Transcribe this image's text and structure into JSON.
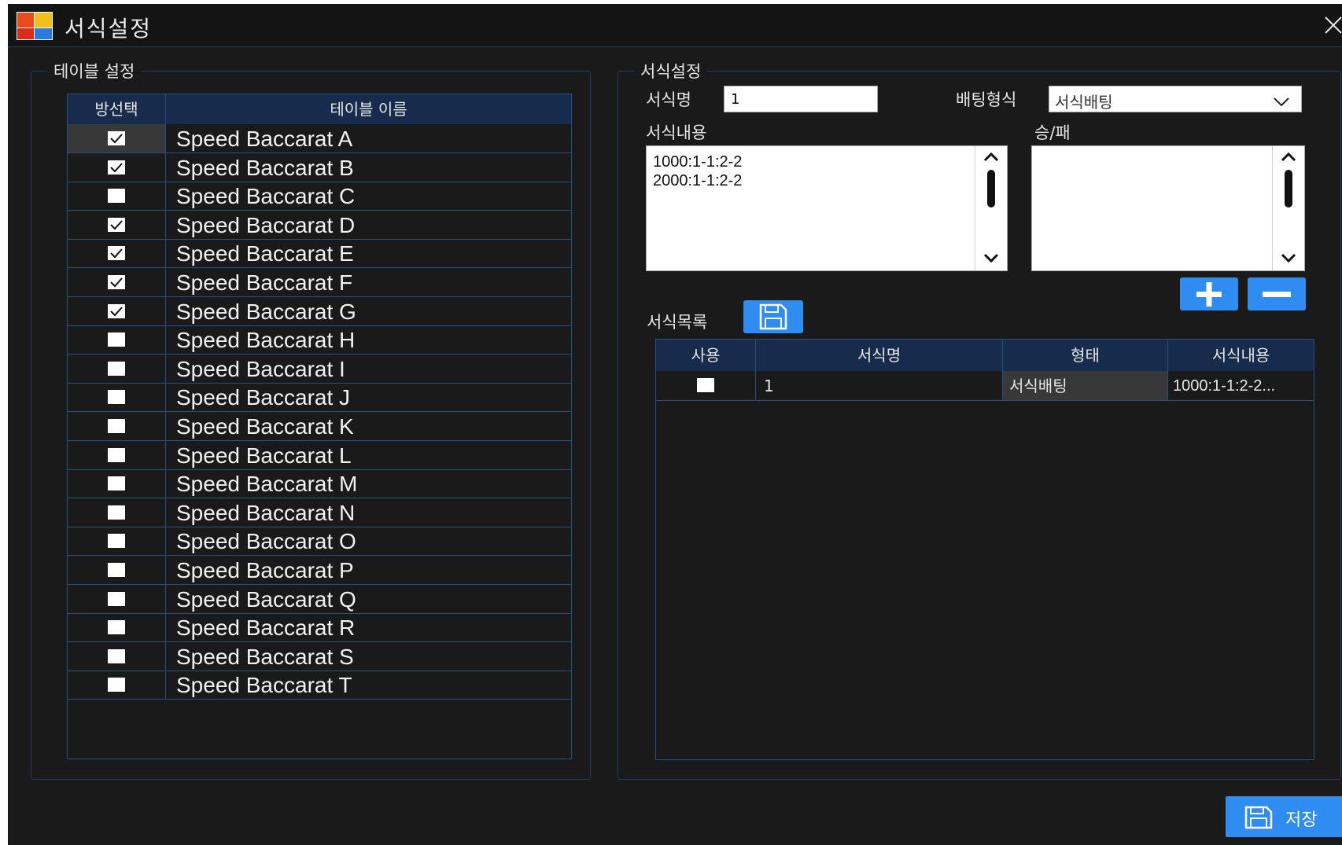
{
  "window": {
    "title": "서식설정"
  },
  "table_settings": {
    "group_title": "테이블 설정",
    "col_select": "방선택",
    "col_name": "테이블 이름",
    "rows": [
      {
        "name": "Speed Baccarat A",
        "checked": true
      },
      {
        "name": "Speed Baccarat B",
        "checked": true
      },
      {
        "name": "Speed Baccarat C",
        "checked": false
      },
      {
        "name": "Speed Baccarat D",
        "checked": true
      },
      {
        "name": "Speed Baccarat E",
        "checked": true
      },
      {
        "name": "Speed Baccarat F",
        "checked": true
      },
      {
        "name": "Speed Baccarat G",
        "checked": true
      },
      {
        "name": "Speed Baccarat H",
        "checked": false
      },
      {
        "name": "Speed Baccarat I",
        "checked": false
      },
      {
        "name": "Speed Baccarat J",
        "checked": false
      },
      {
        "name": "Speed Baccarat K",
        "checked": false
      },
      {
        "name": "Speed Baccarat L",
        "checked": false
      },
      {
        "name": "Speed Baccarat M",
        "checked": false
      },
      {
        "name": "Speed Baccarat N",
        "checked": false
      },
      {
        "name": "Speed Baccarat O",
        "checked": false
      },
      {
        "name": "Speed Baccarat P",
        "checked": false
      },
      {
        "name": "Speed Baccarat Q",
        "checked": false
      },
      {
        "name": "Speed Baccarat R",
        "checked": false
      },
      {
        "name": "Speed Baccarat S",
        "checked": false
      },
      {
        "name": "Speed Baccarat T",
        "checked": false
      }
    ]
  },
  "format_settings": {
    "group_title": "서식설정",
    "name_label": "서식명",
    "name_value": "1",
    "bet_type_label": "배팅형식",
    "bet_type_value": "서식배팅",
    "content_label": "서식내용",
    "content_lines": [
      "1000:1-1:2-2",
      "2000:1-1:2-2"
    ],
    "winlose_label": "승/패",
    "list_label": "서식목록",
    "list": {
      "col_use": "사용",
      "col_name": "서식명",
      "col_type": "형태",
      "col_content": "서식내용",
      "rows": [
        {
          "use": false,
          "name": "1",
          "type": "서식배팅",
          "content": "1000:1-1:2-2..."
        }
      ]
    }
  },
  "footer": {
    "save_label": "저장"
  },
  "colors": {
    "accent": "#2f8cf0",
    "header": "#172c4c",
    "border": "#2a4d80",
    "background": "#1a1a1a"
  }
}
